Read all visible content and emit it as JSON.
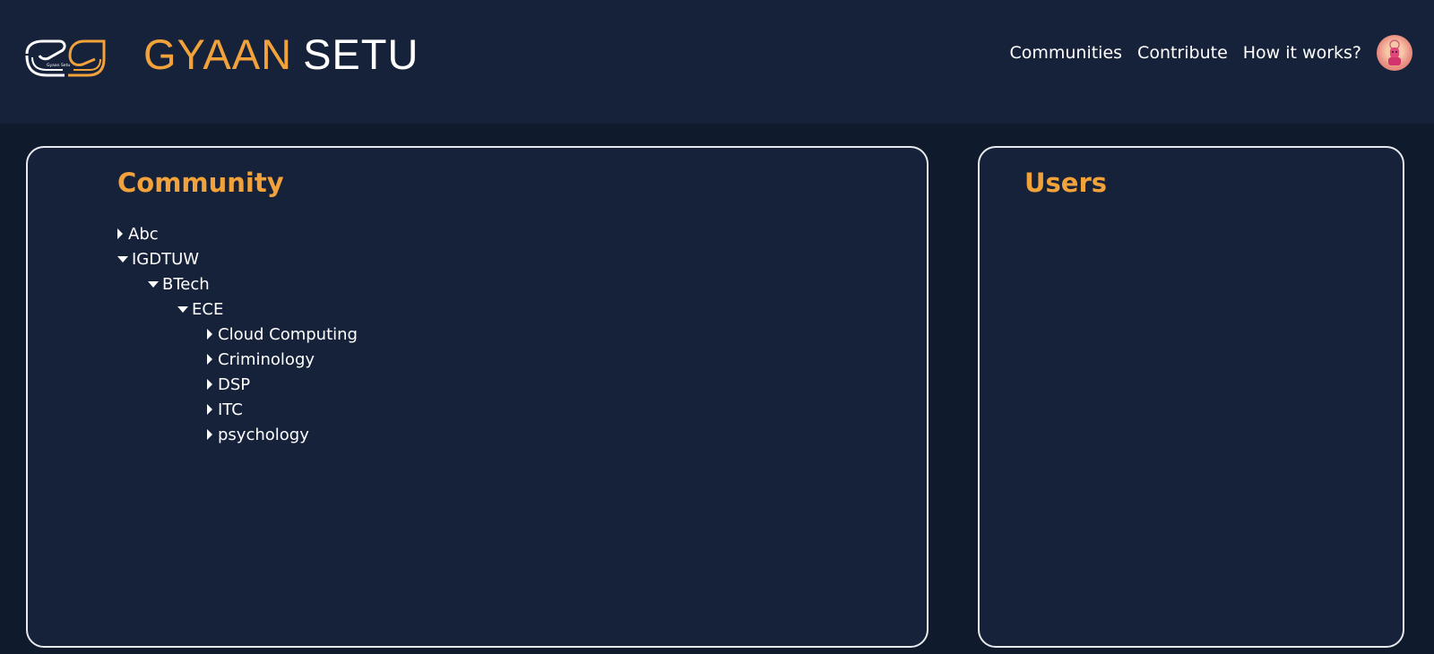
{
  "brand": {
    "title_part1": "GYAAN",
    "title_part2": "SETU",
    "logo_text": "Gyaan Setu"
  },
  "nav": {
    "items": [
      {
        "label": "Communities"
      },
      {
        "label": "Contribute"
      },
      {
        "label": "How it works?"
      }
    ],
    "avatar_icon": "user-avatar-icon"
  },
  "community": {
    "title": "Community",
    "tree": [
      {
        "label": "Abc",
        "expanded": false,
        "level": 0
      },
      {
        "label": "IGDTUW",
        "expanded": true,
        "level": 0
      },
      {
        "label": "BTech",
        "expanded": true,
        "level": 1
      },
      {
        "label": "ECE",
        "expanded": true,
        "level": 2
      },
      {
        "label": "Cloud Computing",
        "expanded": false,
        "level": 3
      },
      {
        "label": "Criminology",
        "expanded": false,
        "level": 3
      },
      {
        "label": "DSP",
        "expanded": false,
        "level": 3
      },
      {
        "label": "ITC",
        "expanded": false,
        "level": 3
      },
      {
        "label": "psychology",
        "expanded": false,
        "level": 3
      }
    ]
  },
  "users": {
    "title": "Users"
  },
  "colors": {
    "accent": "#f2a23a",
    "background": "#101a2d",
    "panel": "#16213a",
    "border": "#e7e9ee"
  }
}
